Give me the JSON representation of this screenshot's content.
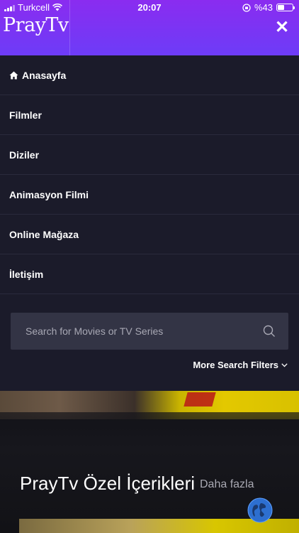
{
  "status_bar": {
    "carrier": "Turkcell",
    "time": "20:07",
    "battery_percent": "%43",
    "battery_level": 0.43
  },
  "header": {
    "logo": "PrayTv",
    "close_icon": "close-icon"
  },
  "menu": {
    "items": [
      {
        "label": "Anasayfa",
        "icon": "home-icon"
      },
      {
        "label": "Filmler"
      },
      {
        "label": "Diziler"
      },
      {
        "label": "Animasyon Filmi"
      },
      {
        "label": "Online Mağaza"
      },
      {
        "label": "İletişim"
      }
    ]
  },
  "search": {
    "placeholder": "Search for Movies or TV Series",
    "more_filters": "More Search Filters"
  },
  "section": {
    "title": "PrayTv Özel İçerikleri",
    "more": "Daha fazla"
  },
  "colors": {
    "header_gradient_start": "#8a2cf0",
    "header_gradient_end": "#6d3cf7",
    "menu_background": "#1b1b2a",
    "search_background": "#333445"
  }
}
